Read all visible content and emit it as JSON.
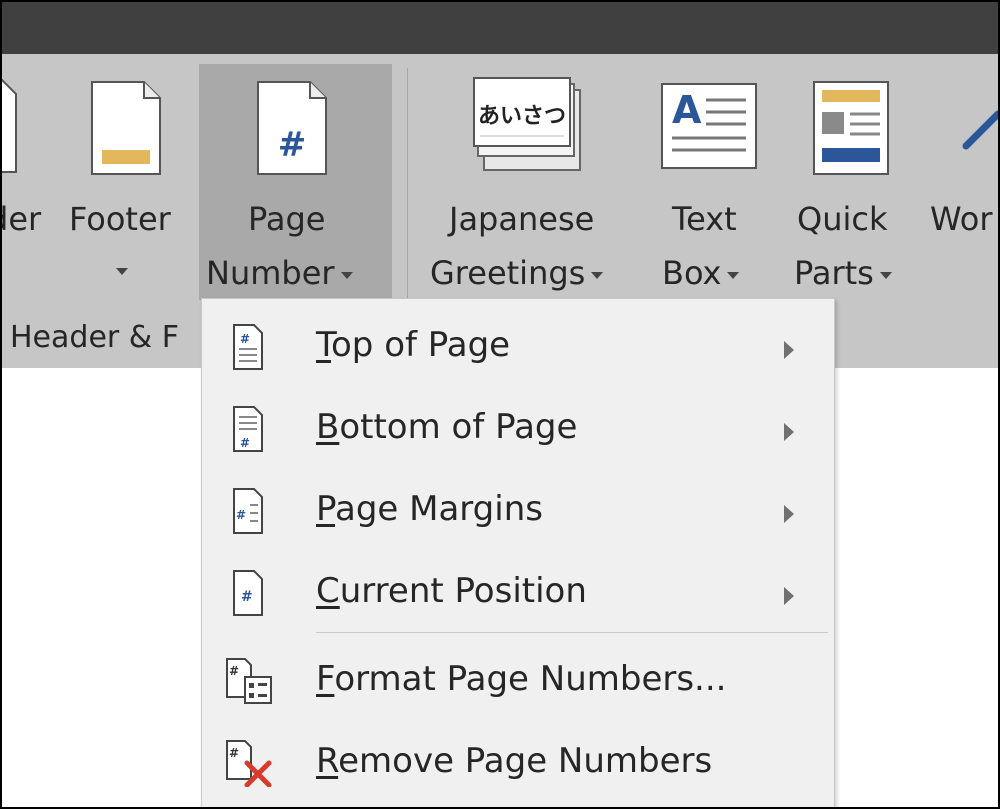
{
  "ribbon": {
    "partial_left_label": "der",
    "footer": {
      "label": "Footer",
      "icon": "footer-icon"
    },
    "page_number": {
      "label_line1": "Page",
      "label_line2": "Number",
      "icon": "page-number-icon"
    },
    "japanese_greetings": {
      "label_line1": "Japanese",
      "label_line2": "Greetings",
      "icon_text": "あいさつ"
    },
    "text_box": {
      "label_line1": "Text",
      "label_line2": "Box",
      "icon_letter": "A"
    },
    "quick_parts": {
      "label_line1": "Quick",
      "label_line2": "Parts"
    },
    "partial_right_label": "Wor",
    "group_label": "Header & F"
  },
  "menu": {
    "items": [
      {
        "label": "Top of Page",
        "accel": "T",
        "rest": "op of Page",
        "submenu": true,
        "icon": "top-of-page-icon"
      },
      {
        "label": "Bottom of Page",
        "accel": "B",
        "rest": "ottom of Page",
        "submenu": true,
        "icon": "bottom-of-page-icon"
      },
      {
        "label": "Page Margins",
        "accel": "P",
        "rest": "age Margins",
        "submenu": true,
        "icon": "page-margins-icon"
      },
      {
        "label": "Current Position",
        "accel": "C",
        "rest": "urrent Position",
        "submenu": true,
        "icon": "current-position-icon"
      },
      {
        "label": "Format Page Numbers...",
        "accel": "F",
        "rest": "ormat Page Numbers...",
        "submenu": false,
        "icon": "format-page-numbers-icon"
      },
      {
        "label": "Remove Page Numbers",
        "accel": "R",
        "rest": "emove Page Numbers",
        "submenu": false,
        "icon": "remove-page-numbers-icon"
      }
    ]
  },
  "colors": {
    "accent_blue": "#2b579a",
    "footer_gold": "#e3b85c",
    "remove_red": "#d83b2b"
  }
}
